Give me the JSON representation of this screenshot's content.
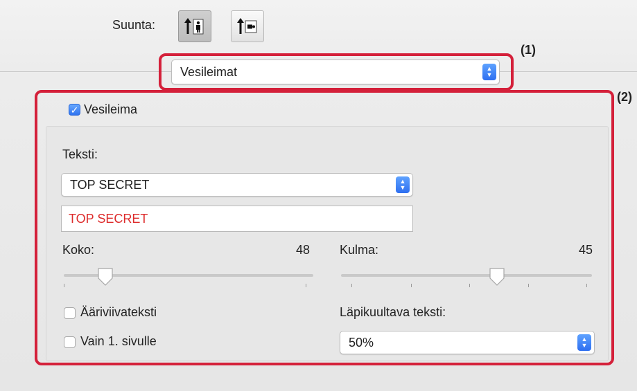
{
  "orientation": {
    "label": "Suunta:",
    "options": [
      "portrait-person-icon",
      "landscape-person-icon"
    ],
    "selected_index": 0
  },
  "section_popup": {
    "value": "Vesileimat"
  },
  "callouts": {
    "one": "(1)",
    "two": "(2)"
  },
  "watermark": {
    "enabled_label": "Vesileima",
    "enabled": true,
    "text_label": "Teksti:",
    "text_select_value": "TOP SECRET",
    "text_field_value": "TOP SECRET",
    "text_field_color": "#dd2b2b",
    "size": {
      "label": "Koko:",
      "value": "48",
      "level": 0.22
    },
    "angle": {
      "label": "Kulma:",
      "value": "45",
      "level": 0.62
    },
    "outline_label": "Ääriviivateksti",
    "first_page_label": "Vain 1. sivulle",
    "transparency_label": "Läpikuultava teksti:",
    "transparency_value": "50%"
  },
  "colors": {
    "highlight_red": "#d4203a",
    "accent_blue": "#2f73f0"
  }
}
